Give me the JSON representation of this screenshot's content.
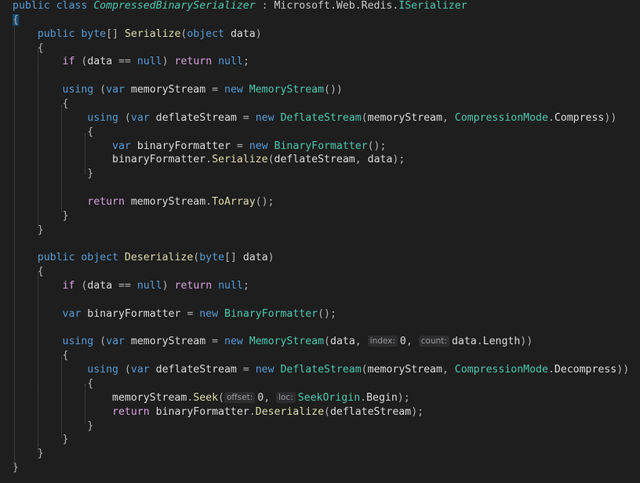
{
  "editor": {
    "lines": [
      [
        {
          "c": "kw",
          "t": "public "
        },
        {
          "c": "kw",
          "t": "class "
        },
        {
          "c": "it",
          "t": "CompressedBinarySerializer"
        },
        {
          "c": "pn",
          "t": " : "
        },
        {
          "c": "ns",
          "t": "Microsoft.Web.Redis."
        },
        {
          "c": "ty",
          "t": "ISerializer"
        }
      ],
      [
        {
          "c": "pn",
          "t": "{",
          "hl": true
        }
      ],
      [
        {
          "c": "id",
          "t": "    "
        },
        {
          "c": "kw",
          "t": "public "
        },
        {
          "c": "kw",
          "t": "byte"
        },
        {
          "c": "pn",
          "t": "[] "
        },
        {
          "c": "fn",
          "t": "Serialize"
        },
        {
          "c": "pn",
          "t": "("
        },
        {
          "c": "kw",
          "t": "object "
        },
        {
          "c": "id",
          "t": "data"
        },
        {
          "c": "pn",
          "t": ")"
        }
      ],
      [
        {
          "c": "pn",
          "t": "    {"
        }
      ],
      [
        {
          "c": "id",
          "t": "        "
        },
        {
          "c": "ctl",
          "t": "if "
        },
        {
          "c": "pn",
          "t": "("
        },
        {
          "c": "id",
          "t": "data "
        },
        {
          "c": "pn",
          "t": "== "
        },
        {
          "c": "kw",
          "t": "null"
        },
        {
          "c": "pn",
          "t": ") "
        },
        {
          "c": "ctl",
          "t": "return "
        },
        {
          "c": "kw",
          "t": "null"
        },
        {
          "c": "pn",
          "t": ";"
        }
      ],
      [],
      [
        {
          "c": "id",
          "t": "        "
        },
        {
          "c": "kw",
          "t": "using "
        },
        {
          "c": "pn",
          "t": "("
        },
        {
          "c": "kw",
          "t": "var "
        },
        {
          "c": "id",
          "t": "memoryStream "
        },
        {
          "c": "pn",
          "t": "= "
        },
        {
          "c": "kw",
          "t": "new "
        },
        {
          "c": "ty",
          "t": "MemoryStream"
        },
        {
          "c": "pn",
          "t": "())"
        }
      ],
      [
        {
          "c": "pn",
          "t": "        {"
        }
      ],
      [
        {
          "c": "id",
          "t": "            "
        },
        {
          "c": "kw",
          "t": "using "
        },
        {
          "c": "pn",
          "t": "("
        },
        {
          "c": "kw",
          "t": "var "
        },
        {
          "c": "id",
          "t": "deflateStream "
        },
        {
          "c": "pn",
          "t": "= "
        },
        {
          "c": "kw",
          "t": "new "
        },
        {
          "c": "ty",
          "t": "DeflateStream"
        },
        {
          "c": "pn",
          "t": "("
        },
        {
          "c": "id",
          "t": "memoryStream"
        },
        {
          "c": "pn",
          "t": ", "
        },
        {
          "c": "ty",
          "t": "CompressionMode"
        },
        {
          "c": "pn",
          "t": "."
        },
        {
          "c": "id",
          "t": "Compress"
        },
        {
          "c": "pn",
          "t": "))"
        }
      ],
      [
        {
          "c": "pn",
          "t": "            {"
        }
      ],
      [
        {
          "c": "id",
          "t": "                "
        },
        {
          "c": "kw",
          "t": "var "
        },
        {
          "c": "id",
          "t": "binaryFormatter "
        },
        {
          "c": "pn",
          "t": "= "
        },
        {
          "c": "kw",
          "t": "new "
        },
        {
          "c": "ty",
          "t": "BinaryFormatter"
        },
        {
          "c": "pn",
          "t": "();"
        }
      ],
      [
        {
          "c": "id",
          "t": "                binaryFormatter"
        },
        {
          "c": "pn",
          "t": "."
        },
        {
          "c": "fn",
          "t": "Serialize"
        },
        {
          "c": "pn",
          "t": "("
        },
        {
          "c": "id",
          "t": "deflateStream"
        },
        {
          "c": "pn",
          "t": ", "
        },
        {
          "c": "id",
          "t": "data"
        },
        {
          "c": "pn",
          "t": ");"
        }
      ],
      [
        {
          "c": "pn",
          "t": "            }"
        }
      ],
      [],
      [
        {
          "c": "id",
          "t": "            "
        },
        {
          "c": "ctl",
          "t": "return "
        },
        {
          "c": "id",
          "t": "memoryStream"
        },
        {
          "c": "pn",
          "t": "."
        },
        {
          "c": "fn",
          "t": "ToArray"
        },
        {
          "c": "pn",
          "t": "();"
        }
      ],
      [
        {
          "c": "pn",
          "t": "        }"
        }
      ],
      [
        {
          "c": "pn",
          "t": "    }"
        }
      ],
      [],
      [
        {
          "c": "id",
          "t": "    "
        },
        {
          "c": "kw",
          "t": "public "
        },
        {
          "c": "kw",
          "t": "object "
        },
        {
          "c": "fn",
          "t": "Deserialize"
        },
        {
          "c": "pn",
          "t": "("
        },
        {
          "c": "kw",
          "t": "byte"
        },
        {
          "c": "pn",
          "t": "[] "
        },
        {
          "c": "id",
          "t": "data"
        },
        {
          "c": "pn",
          "t": ")"
        }
      ],
      [
        {
          "c": "pn",
          "t": "    {"
        }
      ],
      [
        {
          "c": "id",
          "t": "        "
        },
        {
          "c": "ctl",
          "t": "if "
        },
        {
          "c": "pn",
          "t": "("
        },
        {
          "c": "id",
          "t": "data "
        },
        {
          "c": "pn",
          "t": "== "
        },
        {
          "c": "kw",
          "t": "null"
        },
        {
          "c": "pn",
          "t": ") "
        },
        {
          "c": "ctl",
          "t": "return "
        },
        {
          "c": "kw",
          "t": "null"
        },
        {
          "c": "pn",
          "t": ";"
        }
      ],
      [],
      [
        {
          "c": "id",
          "t": "        "
        },
        {
          "c": "kw",
          "t": "var "
        },
        {
          "c": "id",
          "t": "binaryFormatter "
        },
        {
          "c": "pn",
          "t": "= "
        },
        {
          "c": "kw",
          "t": "new "
        },
        {
          "c": "ty",
          "t": "BinaryFormatter"
        },
        {
          "c": "pn",
          "t": "();"
        }
      ],
      [],
      [
        {
          "c": "id",
          "t": "        "
        },
        {
          "c": "kw",
          "t": "using "
        },
        {
          "c": "pn",
          "t": "("
        },
        {
          "c": "kw",
          "t": "var "
        },
        {
          "c": "id",
          "t": "memoryStream "
        },
        {
          "c": "pn",
          "t": "= "
        },
        {
          "c": "kw",
          "t": "new "
        },
        {
          "c": "ty",
          "t": "MemoryStream"
        },
        {
          "c": "pn",
          "t": "("
        },
        {
          "c": "id",
          "t": "data"
        },
        {
          "c": "pn",
          "t": ", "
        },
        {
          "c": "hint",
          "t": "index:"
        },
        {
          "c": "id",
          "t": "0"
        },
        {
          "c": "pn",
          "t": ", "
        },
        {
          "c": "hint",
          "t": "count:"
        },
        {
          "c": "id",
          "t": "data"
        },
        {
          "c": "pn",
          "t": "."
        },
        {
          "c": "id",
          "t": "Length"
        },
        {
          "c": "pn",
          "t": "))"
        }
      ],
      [
        {
          "c": "pn",
          "t": "        {"
        }
      ],
      [
        {
          "c": "id",
          "t": "            "
        },
        {
          "c": "kw",
          "t": "using "
        },
        {
          "c": "pn",
          "t": "("
        },
        {
          "c": "kw",
          "t": "var "
        },
        {
          "c": "id",
          "t": "deflateStream "
        },
        {
          "c": "pn",
          "t": "= "
        },
        {
          "c": "kw",
          "t": "new "
        },
        {
          "c": "ty",
          "t": "DeflateStream"
        },
        {
          "c": "pn",
          "t": "("
        },
        {
          "c": "id",
          "t": "memoryStream"
        },
        {
          "c": "pn",
          "t": ", "
        },
        {
          "c": "ty",
          "t": "CompressionMode"
        },
        {
          "c": "pn",
          "t": "."
        },
        {
          "c": "id",
          "t": "Decompress"
        },
        {
          "c": "pn",
          "t": "))"
        }
      ],
      [
        {
          "c": "pn",
          "t": "            {"
        }
      ],
      [
        {
          "c": "id",
          "t": "                memoryStream"
        },
        {
          "c": "pn",
          "t": "."
        },
        {
          "c": "fn",
          "t": "Seek"
        },
        {
          "c": "pn",
          "t": "("
        },
        {
          "c": "hint",
          "t": "offset:"
        },
        {
          "c": "id",
          "t": "0"
        },
        {
          "c": "pn",
          "t": ", "
        },
        {
          "c": "hint",
          "t": "loc:"
        },
        {
          "c": "ty",
          "t": "SeekOrigin"
        },
        {
          "c": "pn",
          "t": "."
        },
        {
          "c": "id",
          "t": "Begin"
        },
        {
          "c": "pn",
          "t": ");"
        }
      ],
      [
        {
          "c": "id",
          "t": "                "
        },
        {
          "c": "ctl",
          "t": "return "
        },
        {
          "c": "id",
          "t": "binaryFormatter"
        },
        {
          "c": "pn",
          "t": "."
        },
        {
          "c": "fn",
          "t": "Deserialize"
        },
        {
          "c": "pn",
          "t": "("
        },
        {
          "c": "id",
          "t": "deflateStream"
        },
        {
          "c": "pn",
          "t": ");"
        }
      ],
      [
        {
          "c": "pn",
          "t": "            }"
        }
      ],
      [
        {
          "c": "pn",
          "t": "        }"
        }
      ],
      [
        {
          "c": "pn",
          "t": "    }"
        }
      ],
      [
        {
          "c": "pn",
          "t": "}"
        }
      ]
    ],
    "colors": {
      "background": "#1e1e1e",
      "keyword": "#569cd6",
      "type": "#4ec9b0",
      "method": "#dcdcaa",
      "identifier": "#dcdcdc",
      "control": "#d8a0df",
      "hint_background": "#2d2d30"
    }
  }
}
